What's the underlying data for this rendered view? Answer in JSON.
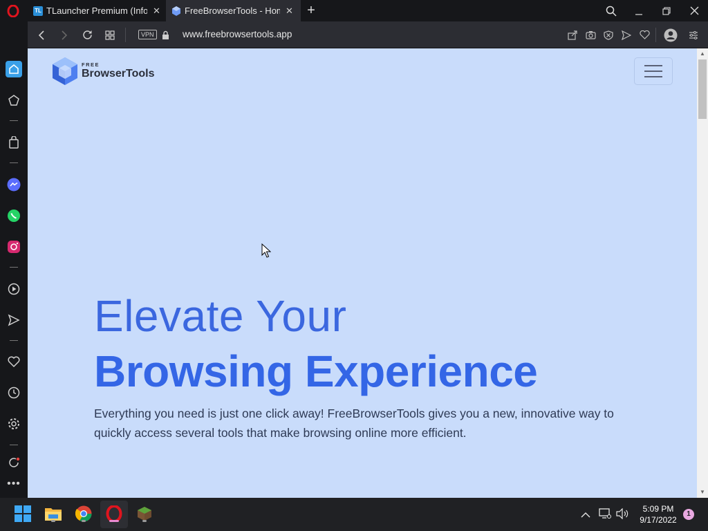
{
  "tabs": [
    {
      "favicon": "TL",
      "title": "TLauncher Premium (Inform",
      "active": false
    },
    {
      "favicon": "cube",
      "title": "FreeBrowserTools - Home",
      "active": true
    }
  ],
  "address_bar": {
    "vpn_label": "VPN",
    "url": "www.freebrowsertools.app"
  },
  "logo": {
    "small_text": "FREE",
    "name": "BrowserTools"
  },
  "hero": {
    "line1": "Elevate Your",
    "line2": "Browsing Experience",
    "description": "Everything you need is just one click away! FreeBrowserTools gives you a new, innovative way to quickly access several tools that make browsing online more efficient."
  },
  "taskbar": {
    "time": "5:09 PM",
    "date": "9/17/2022",
    "notification_count": "1"
  },
  "colors": {
    "page_bg": "#c9dcfb",
    "accent": "#3466e6",
    "opera_red": "#e0141e"
  }
}
